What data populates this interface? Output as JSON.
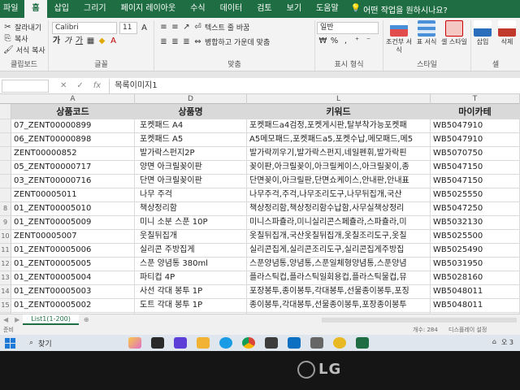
{
  "ribbon": {
    "tabs": [
      {
        "label": "파일"
      },
      {
        "label": "홈",
        "active": true
      },
      {
        "label": "삽입"
      },
      {
        "label": "그리기"
      },
      {
        "label": "페이지 레이아웃"
      },
      {
        "label": "수식"
      },
      {
        "label": "데이터"
      },
      {
        "label": "검토"
      },
      {
        "label": "보기"
      },
      {
        "label": "도움말"
      }
    ],
    "tell_me": "어떤 작업을 원하시나요?",
    "clipboard": {
      "cut": "잘라내기",
      "copy": "복사",
      "format_painter": "서식 복사",
      "label": "클립보드"
    },
    "font": {
      "name": "Calibri",
      "size": "11",
      "label": "글꼴"
    },
    "alignment": {
      "wrap": "텍스트 줄 바꿈",
      "merge": "병합하고 가운데 맞춤",
      "label": "맞춤"
    },
    "number": {
      "format": "일반",
      "percent": "%",
      "comma": ",",
      "label": "표시 형식"
    },
    "styles": {
      "conditional": "조건부 서식",
      "table": "표 서식",
      "cell": "셀 스타일",
      "label": "스타일"
    },
    "cells": {
      "insert": "삽입",
      "delete": "삭제",
      "label": "셀"
    }
  },
  "formula_bar": {
    "value": "목록이미지1"
  },
  "columns": {
    "a": "A",
    "d": "D",
    "l": "L",
    "t": "T"
  },
  "table": {
    "headers": {
      "code": "상품코드",
      "name": "상품명",
      "keyword": "키워드",
      "category": "마이카테"
    },
    "rows": [
      {
        "num": "",
        "code": "07_ZENT00000899",
        "name": "포켓패드 A4",
        "keyword": "포켓패드a4검정,포켓게시판,탈부착가능포켓패",
        "category": "WB5047910"
      },
      {
        "num": "",
        "code": "06_ZENT00000898",
        "name": "포켓패드 A5",
        "keyword": "A5메모패드,포켓패드a5,포켓수납,메모패드,메5",
        "category": "WB5047910"
      },
      {
        "num": "",
        "code": "ZENT00000852",
        "name": "발가락스펀지2P",
        "keyword": "발가락끼우기,발가락스펀지,네일펜휘,발가락핀",
        "category": "WB5070750"
      },
      {
        "num": "",
        "code": "05_ZENT00000717",
        "name": "양면 아크릴꽂이판",
        "keyword": "꽂이판,아크릴꽂이,아크릴케이스,아크릴꽂이,종",
        "category": "WB5047150"
      },
      {
        "num": "",
        "code": "03_ZENT00000716",
        "name": "단면 아크릴꽂이판",
        "keyword": "단면꽂이,아크릴판,단면쇼케이스,안내판,안내표",
        "category": "WB5047150"
      },
      {
        "num": "",
        "code": "ZENT00005011",
        "name": "나무 주걱",
        "keyword": "나무주걱,주걱,나무조리도구,나무뒤집개,국산",
        "category": "WB5025550"
      },
      {
        "num": "8",
        "code": "01_ZENT00005010",
        "name": "책상정리함",
        "keyword": "책상정리함,책상정리함수납함,사무실책상정리",
        "category": "WB5047250"
      },
      {
        "num": "9",
        "code": "01_ZENT00005009",
        "name": "미니 소분 스푼 10P",
        "keyword": "미니스파츌라,미니실리콘스페츌라,스파츌라,미",
        "category": "WB5032130"
      },
      {
        "num": "10",
        "code": "ZENT00005007",
        "name": "웃칠뒤집개",
        "keyword": "옷칠뒤집개,국산옷칠뒤집개,옷칠조리도구,옷칠",
        "category": "WB5025500"
      },
      {
        "num": "11",
        "code": "01_ZENT00005006",
        "name": "실리콘 주방집게",
        "keyword": "실리콘집게,실리콘조리도구,실리콘집게주방집",
        "category": "WB5025490"
      },
      {
        "num": "12",
        "code": "01_ZENT00005005",
        "name": "스푼 양념통 380ml",
        "keyword": "스푼양념통,양념통,스푼일체형양념통,스푼양념",
        "category": "WB5031950"
      },
      {
        "num": "13",
        "code": "01_ZENT00005004",
        "name": "파티컵 4P",
        "keyword": "플라스틱컵,플라스틱일회용컵,플라스틱물컵,뮤",
        "category": "WB5028160"
      },
      {
        "num": "14",
        "code": "01_ZENT00005003",
        "name": "사선 각대 봉투 1P",
        "keyword": "포장봉투,종이봉투,각대봉투,선물종이봉투,포징",
        "category": "WB5048011"
      },
      {
        "num": "15",
        "code": "01_ZENT00005002",
        "name": "도트 각대 봉투 1P",
        "keyword": "종이봉투,각대봉투,선물종이봉투,포장종이봉투",
        "category": "WB5048011"
      },
      {
        "num": "16",
        "code": "01_ZENT00005001",
        "name": "무지 각대 봉투 1P",
        "keyword": "각대봉투,종이봉투,크라프트봉투,크라프트종이",
        "category": "WB5048011"
      }
    ]
  },
  "sheet_tabs": {
    "active": "List1(1-200)",
    "add": "⊕"
  },
  "status": {
    "ready": "준비",
    "count": "개수: 284",
    "display": "디스플레이 설정"
  },
  "taskbar": {
    "search": "찾기",
    "time": "오 3"
  },
  "bezel": {
    "brand": "LG"
  },
  "colors": {
    "excel_green": "#1f6e43",
    "header_gray": "#d9d9d9"
  }
}
